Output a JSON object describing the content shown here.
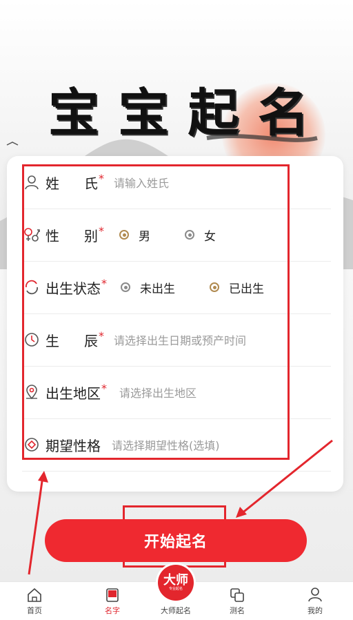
{
  "title_chars": [
    "宝",
    "宝",
    "起",
    "名"
  ],
  "form": {
    "surname": {
      "label_main": "姓",
      "label_last": "氏",
      "required": "*",
      "placeholder": "请输入姓氏"
    },
    "gender": {
      "label_main": "性",
      "label_last": "别",
      "required": "*",
      "options": [
        {
          "label": "男",
          "selected": true
        },
        {
          "label": "女",
          "selected": false
        }
      ]
    },
    "birth_status": {
      "label": "出生状态",
      "required": "*",
      "options": [
        {
          "label": "未出生",
          "selected": false
        },
        {
          "label": "已出生",
          "selected": true
        }
      ]
    },
    "birth_time": {
      "label_main": "生",
      "label_last": "辰",
      "required": "*",
      "placeholder": "请选择出生日期或预产时间"
    },
    "birth_region": {
      "label": "出生地区",
      "required": "*",
      "placeholder": "请选择出生地区"
    },
    "personality": {
      "label": "期望性格",
      "placeholder": "请选择期望性格(选填)"
    }
  },
  "cta": {
    "label": "开始起名"
  },
  "tabbar": {
    "items": [
      {
        "label": "首页",
        "icon": "home-icon"
      },
      {
        "label": "名字",
        "icon": "book-icon",
        "active": true
      },
      {
        "label": "大师起名",
        "icon": "master-seal-icon"
      },
      {
        "label": "测名",
        "icon": "cards-icon"
      },
      {
        "label": "我的",
        "icon": "user-icon"
      }
    ],
    "seal_text": "大师",
    "seal_subtext": "专业起名"
  },
  "colors": {
    "accent": "#e0262e",
    "gold": "#b08a50",
    "radio_gray": "#8a8a8a"
  }
}
